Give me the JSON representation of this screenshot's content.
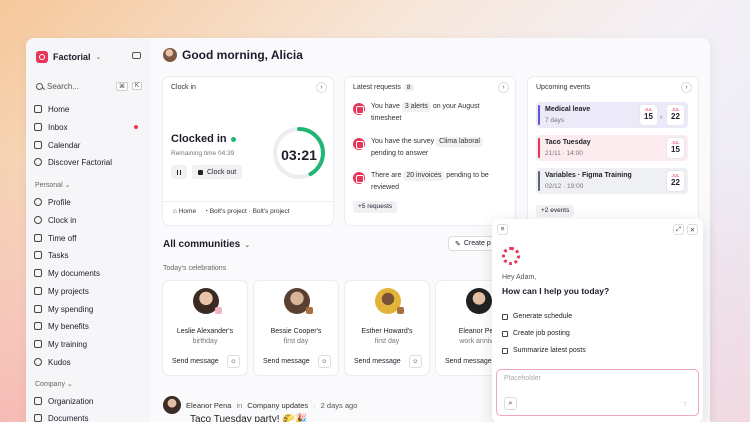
{
  "app": {
    "name": "Factorial"
  },
  "search": {
    "placeholder": "Search...",
    "shortcut_mod": "⌘",
    "shortcut_key": "K"
  },
  "nav": {
    "main": [
      "Home",
      "Inbox",
      "Calendar",
      "Discover Factorial"
    ],
    "personal_label": "Personal",
    "personal": [
      "Profile",
      "Clock in",
      "Time off",
      "Tasks",
      "My documents",
      "My projects",
      "My spending",
      "My benefits",
      "My training",
      "Kudos"
    ],
    "company_label": "Company",
    "company": [
      "Organization",
      "Documents"
    ]
  },
  "greeting": "Good morning, Alicia",
  "clock": {
    "title": "Clock in",
    "state": "Clocked in",
    "remaining": "Remaining time 04:39",
    "clockout_label": "Clock out",
    "timer": "03:21",
    "progress": 0.42,
    "foot_location": "Home",
    "foot_project": "Bolt's project · Bolt's project"
  },
  "requests": {
    "title": "Latest requests",
    "count": "8",
    "items": [
      {
        "pre": "You have",
        "chip": "3 alerts",
        "post": "on your August timesheet"
      },
      {
        "pre": "You have the survey",
        "chip": "Clima laboral",
        "post": "pending to answer"
      },
      {
        "pre": "There are",
        "chip": "20 invoices",
        "post": "pending to be reviewed"
      }
    ],
    "more": "+5 requests"
  },
  "events": {
    "title": "Upcoming events",
    "items": [
      {
        "title": "Medical leave",
        "sub": "7 days",
        "from_m": "JUL",
        "from_d": "15",
        "to_m": "JUL",
        "to_d": "22",
        "color": "#5b56d6",
        "bg": "#eceaf9"
      },
      {
        "title": "Taco Tuesday",
        "sub": "21/11 · 14:00",
        "to_m": "JUL",
        "to_d": "15",
        "color": "#e8365a",
        "bg": "#fdecef"
      },
      {
        "title": "Variables · Figma Training",
        "sub": "02/12 · 19:00",
        "to_m": "JUL",
        "to_d": "22",
        "color": "#5b6578",
        "bg": "#eef0f4"
      }
    ],
    "more": "+2 events"
  },
  "communities": {
    "title": "All communities",
    "create_label": "Create p",
    "today": "Today's celebrations"
  },
  "celebrations": [
    {
      "name": "Leslie Alexander's",
      "reason": "birthday",
      "send": "Send message"
    },
    {
      "name": "Bessie Cooper's",
      "reason": "first day",
      "send": "Send message"
    },
    {
      "name": "Esther Howard's",
      "reason": "first day",
      "send": "Send message"
    },
    {
      "name": "Eleanor Pen",
      "reason": "work annive",
      "send": "Send message"
    }
  ],
  "post": {
    "author": "Eleanor Pena",
    "in_word": "in",
    "channel": "Company updates",
    "time": "2 days ago",
    "title": "Taco Tuesday party! 🌮🎉"
  },
  "assistant": {
    "hey": "Hey Adam,",
    "question": "How can I help you today?",
    "actions": [
      "Generate schedule",
      "Create job posting",
      "Summarize latest posts"
    ],
    "placeholder": "Placeholder"
  }
}
